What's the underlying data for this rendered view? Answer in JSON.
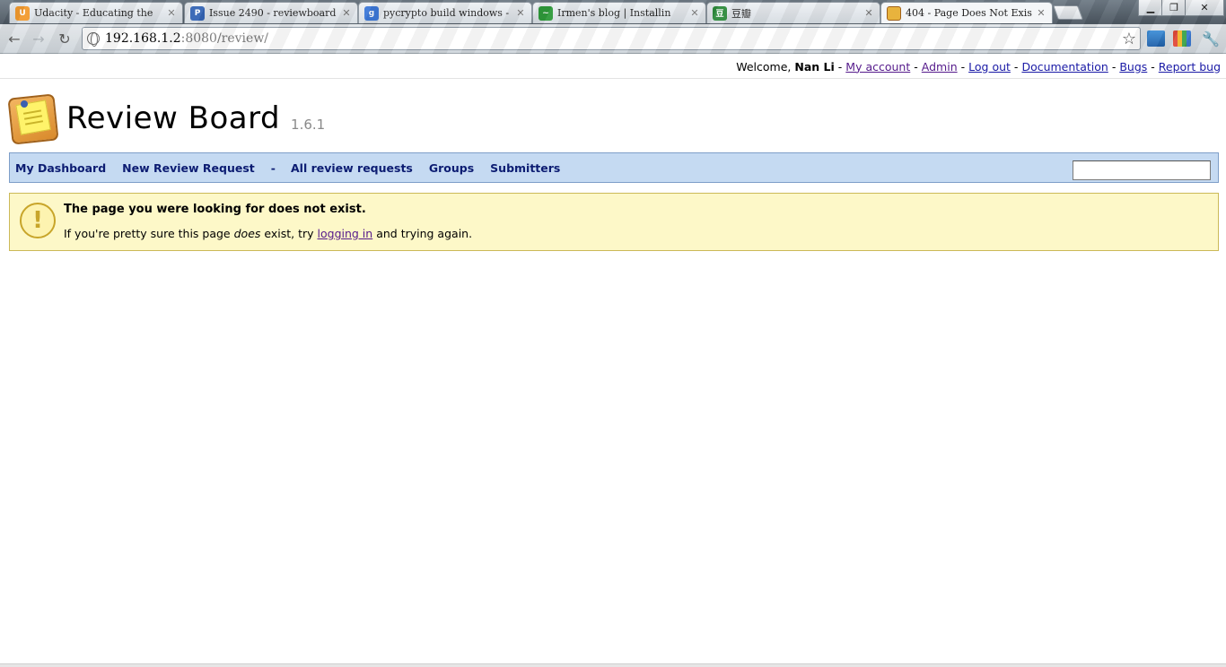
{
  "browser": {
    "tabs": [
      {
        "title": "Udacity - Educating the",
        "icon": "udacity-icon",
        "icon_color": "#f29a2e",
        "icon_text": "U"
      },
      {
        "title": "Issue 2490 - reviewboard",
        "icon": "project-icon",
        "icon_color": "#3464b4",
        "icon_text": "P"
      },
      {
        "title": "pycrypto build windows -",
        "icon": "google-icon",
        "icon_color": "#3c78d8",
        "icon_text": "g"
      },
      {
        "title": "Irmen's blog | Installin",
        "icon": "blog-icon",
        "icon_color": "#2e9a3a",
        "icon_text": "~"
      },
      {
        "title": "豆瓣",
        "icon": "douban-icon",
        "icon_color": "#2d8a3b",
        "icon_text": "豆"
      },
      {
        "title": "404 - Page Does Not Exis",
        "icon": "reviewboard-icon",
        "icon_color": "#e8b33d",
        "icon_text": ""
      }
    ],
    "address": {
      "host": "192.168.1.2",
      "rest": ":8080/review/"
    }
  },
  "account": {
    "welcome": "Welcome,",
    "user": "Nan Li",
    "links": [
      "My account",
      "Admin",
      "Log out",
      "Documentation",
      "Bugs",
      "Report bug"
    ]
  },
  "header": {
    "title": "Review Board",
    "version": "1.6.1"
  },
  "nav": {
    "items": [
      "My Dashboard",
      "New Review Request",
      "All review requests",
      "Groups",
      "Submitters"
    ],
    "separator": "-"
  },
  "error": {
    "title": "The page you were looking for does not exist.",
    "text_before": "If you're pretty sure this page",
    "text_emph": "does",
    "text_mid": "exist, try",
    "link": "logging in",
    "text_after": "and trying again."
  }
}
